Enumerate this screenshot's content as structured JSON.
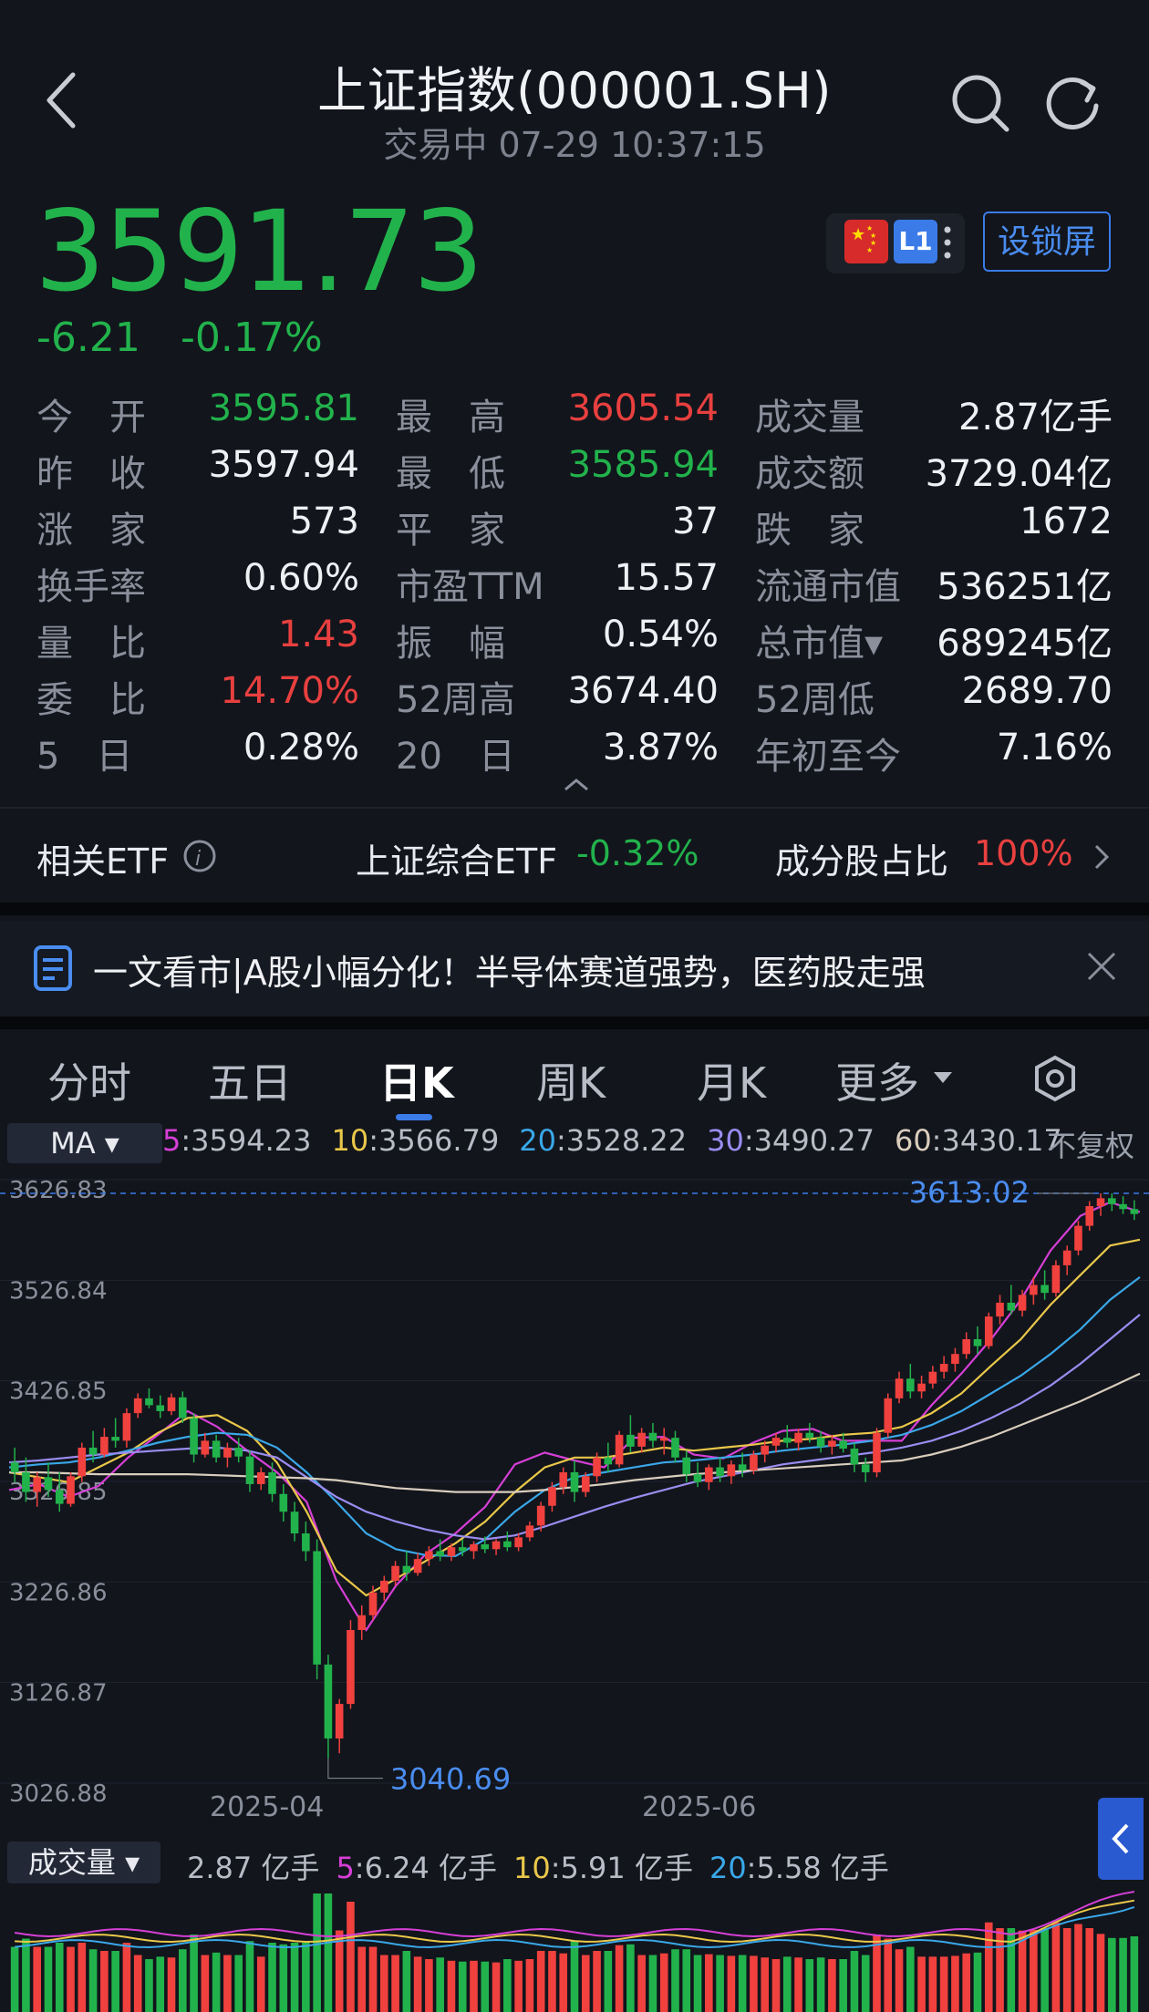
{
  "header": {
    "title": "上证指数(000001.SH)",
    "subtitle": "交易中 07-29 10:37:15"
  },
  "quote": {
    "price": "3591.73",
    "change": "-6.21",
    "change_pct": "-0.17%",
    "badge": "L1",
    "lock_button": "设锁屏"
  },
  "stats": [
    [
      {
        "label": "今　开",
        "value": "3595.81",
        "color": "green"
      },
      {
        "label": "最　高",
        "value": "3605.54",
        "color": "red"
      },
      {
        "label": "成交量",
        "value": "2.87亿手",
        "color": "white"
      }
    ],
    [
      {
        "label": "昨　收",
        "value": "3597.94",
        "color": "white"
      },
      {
        "label": "最　低",
        "value": "3585.94",
        "color": "green"
      },
      {
        "label": "成交额",
        "value": "3729.04亿",
        "color": "white"
      }
    ],
    [
      {
        "label": "涨　家",
        "value": "573",
        "color": "white"
      },
      {
        "label": "平　家",
        "value": "37",
        "color": "white"
      },
      {
        "label": "跌　家",
        "value": "1672",
        "color": "white"
      }
    ],
    [
      {
        "label": "换手率",
        "value": "0.60%",
        "color": "white"
      },
      {
        "label": "市盈TTM",
        "value": "15.57",
        "color": "white"
      },
      {
        "label": "流通市值",
        "value": "536251亿",
        "color": "white"
      }
    ],
    [
      {
        "label": "量　比",
        "value": "1.43",
        "color": "red"
      },
      {
        "label": "振　幅",
        "value": "0.54%",
        "color": "white"
      },
      {
        "label": "总市值▾",
        "value": "689245亿",
        "color": "white"
      }
    ],
    [
      {
        "label": "委　比",
        "value": "14.70%",
        "color": "red"
      },
      {
        "label": "52周高",
        "value": "3674.40",
        "color": "white"
      },
      {
        "label": "52周低",
        "value": "2689.70",
        "color": "white"
      }
    ],
    [
      {
        "label": "5　日",
        "value": "0.28%",
        "color": "white"
      },
      {
        "label": "20　日",
        "value": "3.87%",
        "color": "white"
      },
      {
        "label": "年初至今",
        "value": "7.16%",
        "color": "white"
      }
    ]
  ],
  "etf": {
    "label": "相关ETF",
    "name": "上证综合ETF",
    "name_pct": "-0.32%",
    "ratio_label": "成分股占比",
    "ratio": "100%"
  },
  "news": {
    "text": "一文看市|A股小幅分化！半导体赛道强势，医药股走强"
  },
  "tabs": [
    "分时",
    "五日",
    "日K",
    "周K",
    "月K",
    "更多"
  ],
  "active_tab": "日K",
  "ma_legend": {
    "button": "MA",
    "items": [
      {
        "k": "5",
        "v": ":3594.23",
        "color": "#d63fd6"
      },
      {
        "k": "10",
        "v": ":3566.79",
        "color": "#e9c74a"
      },
      {
        "k": "20",
        "v": ":3528.22",
        "color": "#3aa7e8"
      },
      {
        "k": "30",
        "v": ":3490.27",
        "color": "#9b8cf0"
      },
      {
        "k": "60",
        "v": ":3430.17",
        "color": "#d9cdbd"
      }
    ],
    "adjust": "不复权"
  },
  "volume_legend": {
    "button": "成交量",
    "total": "2.87 亿手",
    "items": [
      {
        "k": "5",
        "v": ":6.24 亿手",
        "color": "#d63fd6"
      },
      {
        "k": "10",
        "v": ":5.91 亿手",
        "color": "#e9c74a"
      },
      {
        "k": "20",
        "v": ":5.58 亿手",
        "color": "#3aa7e8"
      }
    ]
  },
  "chart_data": {
    "type": "candlestick",
    "y_ticks": [
      "3626.83",
      "3526.84",
      "3426.85",
      "3326.85",
      "3226.86",
      "3126.87",
      "3026.88"
    ],
    "x_labels": [
      "2025-04",
      "2025-06"
    ],
    "ylim": [
      3026.88,
      3626.83
    ],
    "max_label": "3613.02",
    "min_label": "3040.69",
    "grid": true,
    "candles": [
      [
        3340,
        3355,
        3320,
        3330
      ],
      [
        3330,
        3345,
        3300,
        3310
      ],
      [
        3310,
        3330,
        3295,
        3325
      ],
      [
        3325,
        3340,
        3305,
        3312
      ],
      [
        3312,
        3330,
        3290,
        3298
      ],
      [
        3298,
        3330,
        3295,
        3326
      ],
      [
        3326,
        3360,
        3320,
        3355
      ],
      [
        3355,
        3372,
        3340,
        3348
      ],
      [
        3348,
        3375,
        3345,
        3366
      ],
      [
        3366,
        3385,
        3355,
        3362
      ],
      [
        3362,
        3395,
        3355,
        3390
      ],
      [
        3390,
        3410,
        3385,
        3405
      ],
      [
        3405,
        3415,
        3395,
        3398
      ],
      [
        3398,
        3408,
        3385,
        3392
      ],
      [
        3392,
        3410,
        3388,
        3406
      ],
      [
        3406,
        3412,
        3380,
        3385
      ],
      [
        3385,
        3390,
        3340,
        3348
      ],
      [
        3348,
        3370,
        3345,
        3362
      ],
      [
        3362,
        3368,
        3340,
        3345
      ],
      [
        3345,
        3360,
        3335,
        3355
      ],
      [
        3355,
        3365,
        3340,
        3346
      ],
      [
        3346,
        3352,
        3310,
        3318
      ],
      [
        3318,
        3335,
        3312,
        3330
      ],
      [
        3330,
        3340,
        3300,
        3308
      ],
      [
        3308,
        3318,
        3280,
        3290
      ],
      [
        3290,
        3300,
        3260,
        3268
      ],
      [
        3268,
        3280,
        3240,
        3250
      ],
      [
        3250,
        3262,
        3120,
        3135
      ],
      [
        3135,
        3145,
        3040,
        3060
      ],
      [
        3060,
        3100,
        3045,
        3095
      ],
      [
        3095,
        3180,
        3090,
        3170
      ],
      [
        3170,
        3195,
        3160,
        3185
      ],
      [
        3185,
        3215,
        3180,
        3208
      ],
      [
        3208,
        3225,
        3200,
        3220
      ],
      [
        3220,
        3240,
        3215,
        3235
      ],
      [
        3235,
        3250,
        3220,
        3228
      ],
      [
        3228,
        3248,
        3225,
        3242
      ],
      [
        3242,
        3255,
        3235,
        3250
      ],
      [
        3250,
        3262,
        3240,
        3245
      ],
      [
        3245,
        3258,
        3240,
        3254
      ],
      [
        3254,
        3262,
        3245,
        3250
      ],
      [
        3250,
        3260,
        3242,
        3257
      ],
      [
        3257,
        3265,
        3248,
        3252
      ],
      [
        3252,
        3262,
        3246,
        3260
      ],
      [
        3260,
        3270,
        3250,
        3254
      ],
      [
        3254,
        3268,
        3250,
        3264
      ],
      [
        3264,
        3280,
        3260,
        3276
      ],
      [
        3276,
        3300,
        3270,
        3296
      ],
      [
        3296,
        3320,
        3290,
        3315
      ],
      [
        3315,
        3335,
        3308,
        3330
      ],
      [
        3330,
        3342,
        3300,
        3310
      ],
      [
        3310,
        3330,
        3305,
        3326
      ],
      [
        3326,
        3350,
        3320,
        3345
      ],
      [
        3345,
        3360,
        3330,
        3338
      ],
      [
        3338,
        3372,
        3335,
        3368
      ],
      [
        3368,
        3388,
        3350,
        3356
      ],
      [
        3356,
        3375,
        3350,
        3370
      ],
      [
        3370,
        3380,
        3355,
        3362
      ],
      [
        3362,
        3375,
        3348,
        3365
      ],
      [
        3365,
        3372,
        3340,
        3345
      ],
      [
        3345,
        3352,
        3320,
        3328
      ],
      [
        3328,
        3340,
        3315,
        3320
      ],
      [
        3320,
        3338,
        3312,
        3335
      ],
      [
        3335,
        3345,
        3320,
        3326
      ],
      [
        3326,
        3342,
        3318,
        3338
      ],
      [
        3338,
        3350,
        3325,
        3332
      ],
      [
        3332,
        3352,
        3328,
        3348
      ],
      [
        3348,
        3362,
        3340,
        3357
      ],
      [
        3357,
        3370,
        3350,
        3365
      ],
      [
        3365,
        3378,
        3355,
        3360
      ],
      [
        3360,
        3374,
        3352,
        3370
      ],
      [
        3370,
        3380,
        3360,
        3365
      ],
      [
        3365,
        3372,
        3350,
        3356
      ],
      [
        3356,
        3368,
        3348,
        3362
      ],
      [
        3362,
        3370,
        3350,
        3354
      ],
      [
        3354,
        3360,
        3330,
        3338
      ],
      [
        3338,
        3345,
        3320,
        3330
      ],
      [
        3330,
        3375,
        3325,
        3370
      ],
      [
        3370,
        3410,
        3365,
        3405
      ],
      [
        3405,
        3432,
        3400,
        3425
      ],
      [
        3425,
        3440,
        3405,
        3412
      ],
      [
        3412,
        3428,
        3405,
        3420
      ],
      [
        3420,
        3438,
        3415,
        3432
      ],
      [
        3432,
        3448,
        3425,
        3440
      ],
      [
        3440,
        3456,
        3432,
        3450
      ],
      [
        3450,
        3472,
        3445,
        3465
      ],
      [
        3465,
        3478,
        3450,
        3458
      ],
      [
        3458,
        3492,
        3455,
        3488
      ],
      [
        3488,
        3510,
        3480,
        3502
      ],
      [
        3502,
        3520,
        3490,
        3494
      ],
      [
        3494,
        3515,
        3488,
        3510
      ],
      [
        3510,
        3528,
        3500,
        3520
      ],
      [
        3520,
        3535,
        3505,
        3512
      ],
      [
        3512,
        3545,
        3508,
        3540
      ],
      [
        3540,
        3560,
        3530,
        3555
      ],
      [
        3555,
        3585,
        3550,
        3580
      ],
      [
        3580,
        3605,
        3575,
        3600
      ],
      [
        3600,
        3613,
        3590,
        3608
      ],
      [
        3608,
        3613,
        3595,
        3602
      ],
      [
        3602,
        3610,
        3592,
        3597
      ],
      [
        3597,
        3606,
        3586,
        3592
      ]
    ],
    "ma_series": [
      {
        "name": "5",
        "color": "#d63fd6",
        "values": [
          3312,
          3318,
          3305,
          3316,
          3345,
          3368,
          3392,
          3376,
          3352,
          3330,
          3300,
          3220,
          3170,
          3215,
          3247,
          3268,
          3295,
          3338,
          3350,
          3342,
          3335,
          3365,
          3366,
          3348,
          3344,
          3360,
          3372,
          3374,
          3362,
          3362,
          3362,
          3398,
          3430,
          3465,
          3505,
          3555,
          3590,
          3604,
          3594
        ]
      },
      {
        "name": "10",
        "color": "#e9c74a",
        "values": [
          3330,
          3325,
          3320,
          3335,
          3350,
          3370,
          3385,
          3388,
          3372,
          3340,
          3290,
          3230,
          3205,
          3222,
          3240,
          3258,
          3280,
          3310,
          3335,
          3345,
          3345,
          3350,
          3355,
          3352,
          3355,
          3358,
          3362,
          3364,
          3368,
          3370,
          3376,
          3390,
          3410,
          3438,
          3465,
          3500,
          3530,
          3560,
          3566
        ]
      },
      {
        "name": "20",
        "color": "#3aa7e8",
        "values": [
          3335,
          3338,
          3340,
          3345,
          3352,
          3360,
          3366,
          3370,
          3368,
          3355,
          3330,
          3300,
          3268,
          3252,
          3246,
          3245,
          3262,
          3290,
          3312,
          3325,
          3330,
          3335,
          3340,
          3342,
          3345,
          3348,
          3352,
          3355,
          3358,
          3362,
          3368,
          3378,
          3392,
          3410,
          3428,
          3450,
          3475,
          3505,
          3528
        ]
      },
      {
        "name": "30",
        "color": "#9b8cf0",
        "values": [
          3340,
          3342,
          3345,
          3348,
          3350,
          3352,
          3354,
          3355,
          3352,
          3345,
          3325,
          3305,
          3290,
          3280,
          3272,
          3266,
          3262,
          3266,
          3275,
          3285,
          3295,
          3304,
          3312,
          3320,
          3326,
          3332,
          3338,
          3342,
          3346,
          3350,
          3355,
          3362,
          3372,
          3385,
          3400,
          3418,
          3440,
          3465,
          3490
        ]
      },
      {
        "name": "60",
        "color": "#d9cdbd",
        "values": [
          3330,
          3330,
          3329,
          3328,
          3328,
          3328,
          3328,
          3327,
          3326,
          3325,
          3324,
          3322,
          3318,
          3314,
          3312,
          3310,
          3310,
          3310,
          3312,
          3315,
          3318,
          3322,
          3325,
          3328,
          3330,
          3332,
          3334,
          3336,
          3338,
          3340,
          3342,
          3348,
          3356,
          3366,
          3378,
          3390,
          3402,
          3416,
          3430
        ]
      }
    ]
  }
}
